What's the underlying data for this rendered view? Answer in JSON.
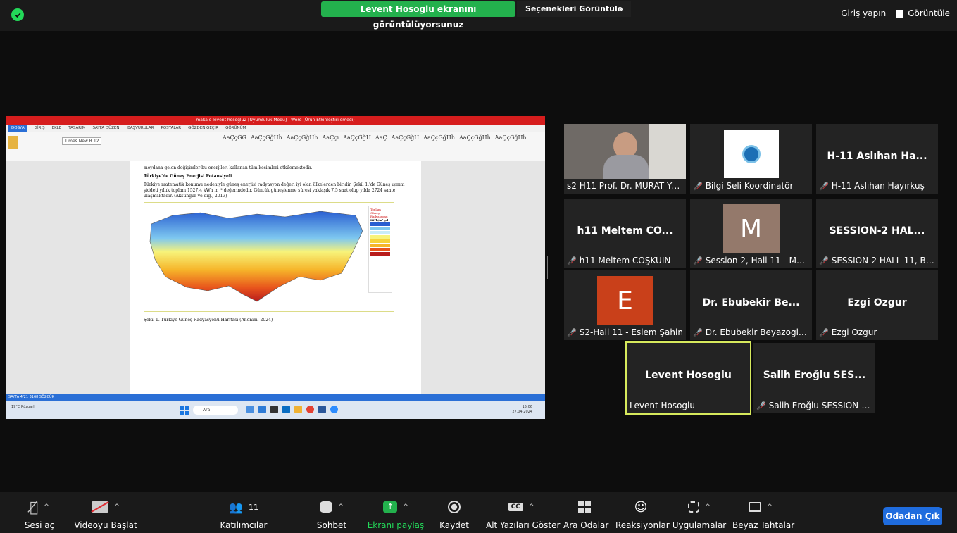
{
  "top": {
    "share_banner": "Levent Hosoglu ekranını görüntülüyorsunuz",
    "view_options": "Seçenekleri Görüntüle",
    "login": "Giriş yapın",
    "view": "Görüntüle"
  },
  "shared_screen": {
    "title": "makale levent hosoglu2 [Uyumluluk Modu] - Word (Ürün Etkinleştirilemedi)",
    "tabs": [
      "DOSYA",
      "GİRİŞ",
      "EKLE",
      "TASARIM",
      "SAYFA DÜZENİ",
      "BAŞVURULAR",
      "POSTALAR",
      "GÖZDEN GEÇİR",
      "GÖRÜNÜM"
    ],
    "font": "Times New R",
    "font_size": "12",
    "styles": [
      "AaÇçĞĞ",
      "AaÇçĞğHh",
      "AaÇçĞğHh",
      "AaÇçı",
      "AaÇçĞğH",
      "AaÇ",
      "AaÇçĞğH",
      "AaÇçĞğHh",
      "AaÇçĞğHh",
      "AaÇçĞğHh"
    ],
    "line1": "meydana gelen değişimler bu enerjileri kullanan tüm kesimleri etkilemektedir.",
    "heading": "Türkiye'de Güneş Enerjisi Potansiyeli",
    "para": "Türkiye matematik konumu nedeniyle güneş enerjisi radyasyon değeri iyi olan ülkelerden biridir. Şekil 1.'de Güneş ışınım şiddeti yıllık toplam 1527.4 kWh m⁻² değerindedir. Güntük güneşlenme süresi yaklaşık 7.5 saat olup yılda 2724 saate ulaşmaktadır. (Aksungur ve diğ., 2013)",
    "caption": "Şekil 1. Türkiye Güneş Radyasyonu Haritası (Anonim, 2024)",
    "legend_title": "Toplam Güneş Radyasyonu",
    "legend_unit": "KWh/m²-yıl",
    "status": "SAYFA 4/21   3168 SÖZCÜK",
    "taskbar_search": "Ara",
    "weather": "19°C Rüzgarlı",
    "clock_time": "15:06",
    "clock_date": "27.04.2024"
  },
  "participants": [
    {
      "big": "",
      "label": "s2 H11 Prof. Dr. MURAT YA...",
      "muted": false,
      "avatar": "photo"
    },
    {
      "big": "",
      "label": "Bilgi Seli Koordinatör",
      "muted": true,
      "avatar": "logo"
    },
    {
      "big": "H-11 Aslıhan Ha...",
      "label": "H-11 Aslıhan Hayırkuş",
      "muted": true
    },
    {
      "big": "h11 Meltem CO...",
      "label": "h11 Meltem COŞKUIN",
      "muted": true
    },
    {
      "big": "M",
      "label": "Session 2, Hall 11 - Mah...",
      "muted": true,
      "avatar": "letter"
    },
    {
      "big": "SESSION-2 HAL...",
      "label": "SESSION-2 HALL-11, Bur...",
      "muted": true
    },
    {
      "big": "E",
      "label": "S2-Hall 11 - Eslem Şahin",
      "muted": true,
      "avatar": "letter"
    },
    {
      "big": "Dr. Ebubekir Be...",
      "label": "Dr. Ebubekir Beyazoglu-...",
      "muted": true
    },
    {
      "big": "Ezgi Ozgur",
      "label": "Ezgi Ozgur",
      "muted": true
    },
    {
      "big": "Levent Hosoglu",
      "label": "Levent Hosoglu",
      "muted": false
    },
    {
      "big": "Salih Eroğlu SES...",
      "label": "Salih Eroğlu SESSION-2 ...",
      "muted": true
    }
  ],
  "controls": {
    "unmute": "Sesi aç",
    "start_video": "Videoyu Başlat",
    "participants": "Katılımcılar",
    "participants_count": "11",
    "chat": "Sohbet",
    "share_screen": "Ekranı paylaş",
    "record": "Kaydet",
    "captions": "Alt Yazıları Göster",
    "captions_badge": "CC",
    "breakout": "Ara Odalar",
    "reactions": "Reaksiyonlar",
    "apps": "Uygulamalar",
    "whiteboards": "Beyaz Tahtalar",
    "leave": "Odadan Çık"
  },
  "colors": {
    "share_green": "#23b14d",
    "speaker_border": "#d6e95c",
    "leave_blue": "#1f6cde",
    "muted_red": "#e0282e"
  }
}
